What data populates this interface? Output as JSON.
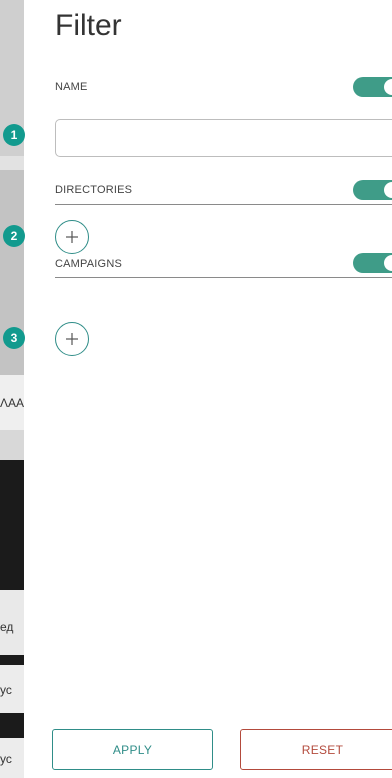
{
  "background_app": {
    "fragments": [
      "ΛΑΑ",
      "ед",
      "ус",
      "ус"
    ]
  },
  "filter": {
    "title": "Filter",
    "name": {
      "label": "NAME",
      "toggle_on": true,
      "input_value": "",
      "badge": "1"
    },
    "directories": {
      "label": "DIRECTORIES",
      "toggle_on": true,
      "badge": "2"
    },
    "campaigns": {
      "label": "CAMPAIGNS",
      "toggle_on": true,
      "badge": "3"
    },
    "apply_label": "APPLY",
    "reset_label": "RESET"
  },
  "colors": {
    "accent": "#3f9c88",
    "badge": "#129a8e",
    "reset": "#b34a3c"
  },
  "icons": {
    "add": "plus-icon"
  }
}
